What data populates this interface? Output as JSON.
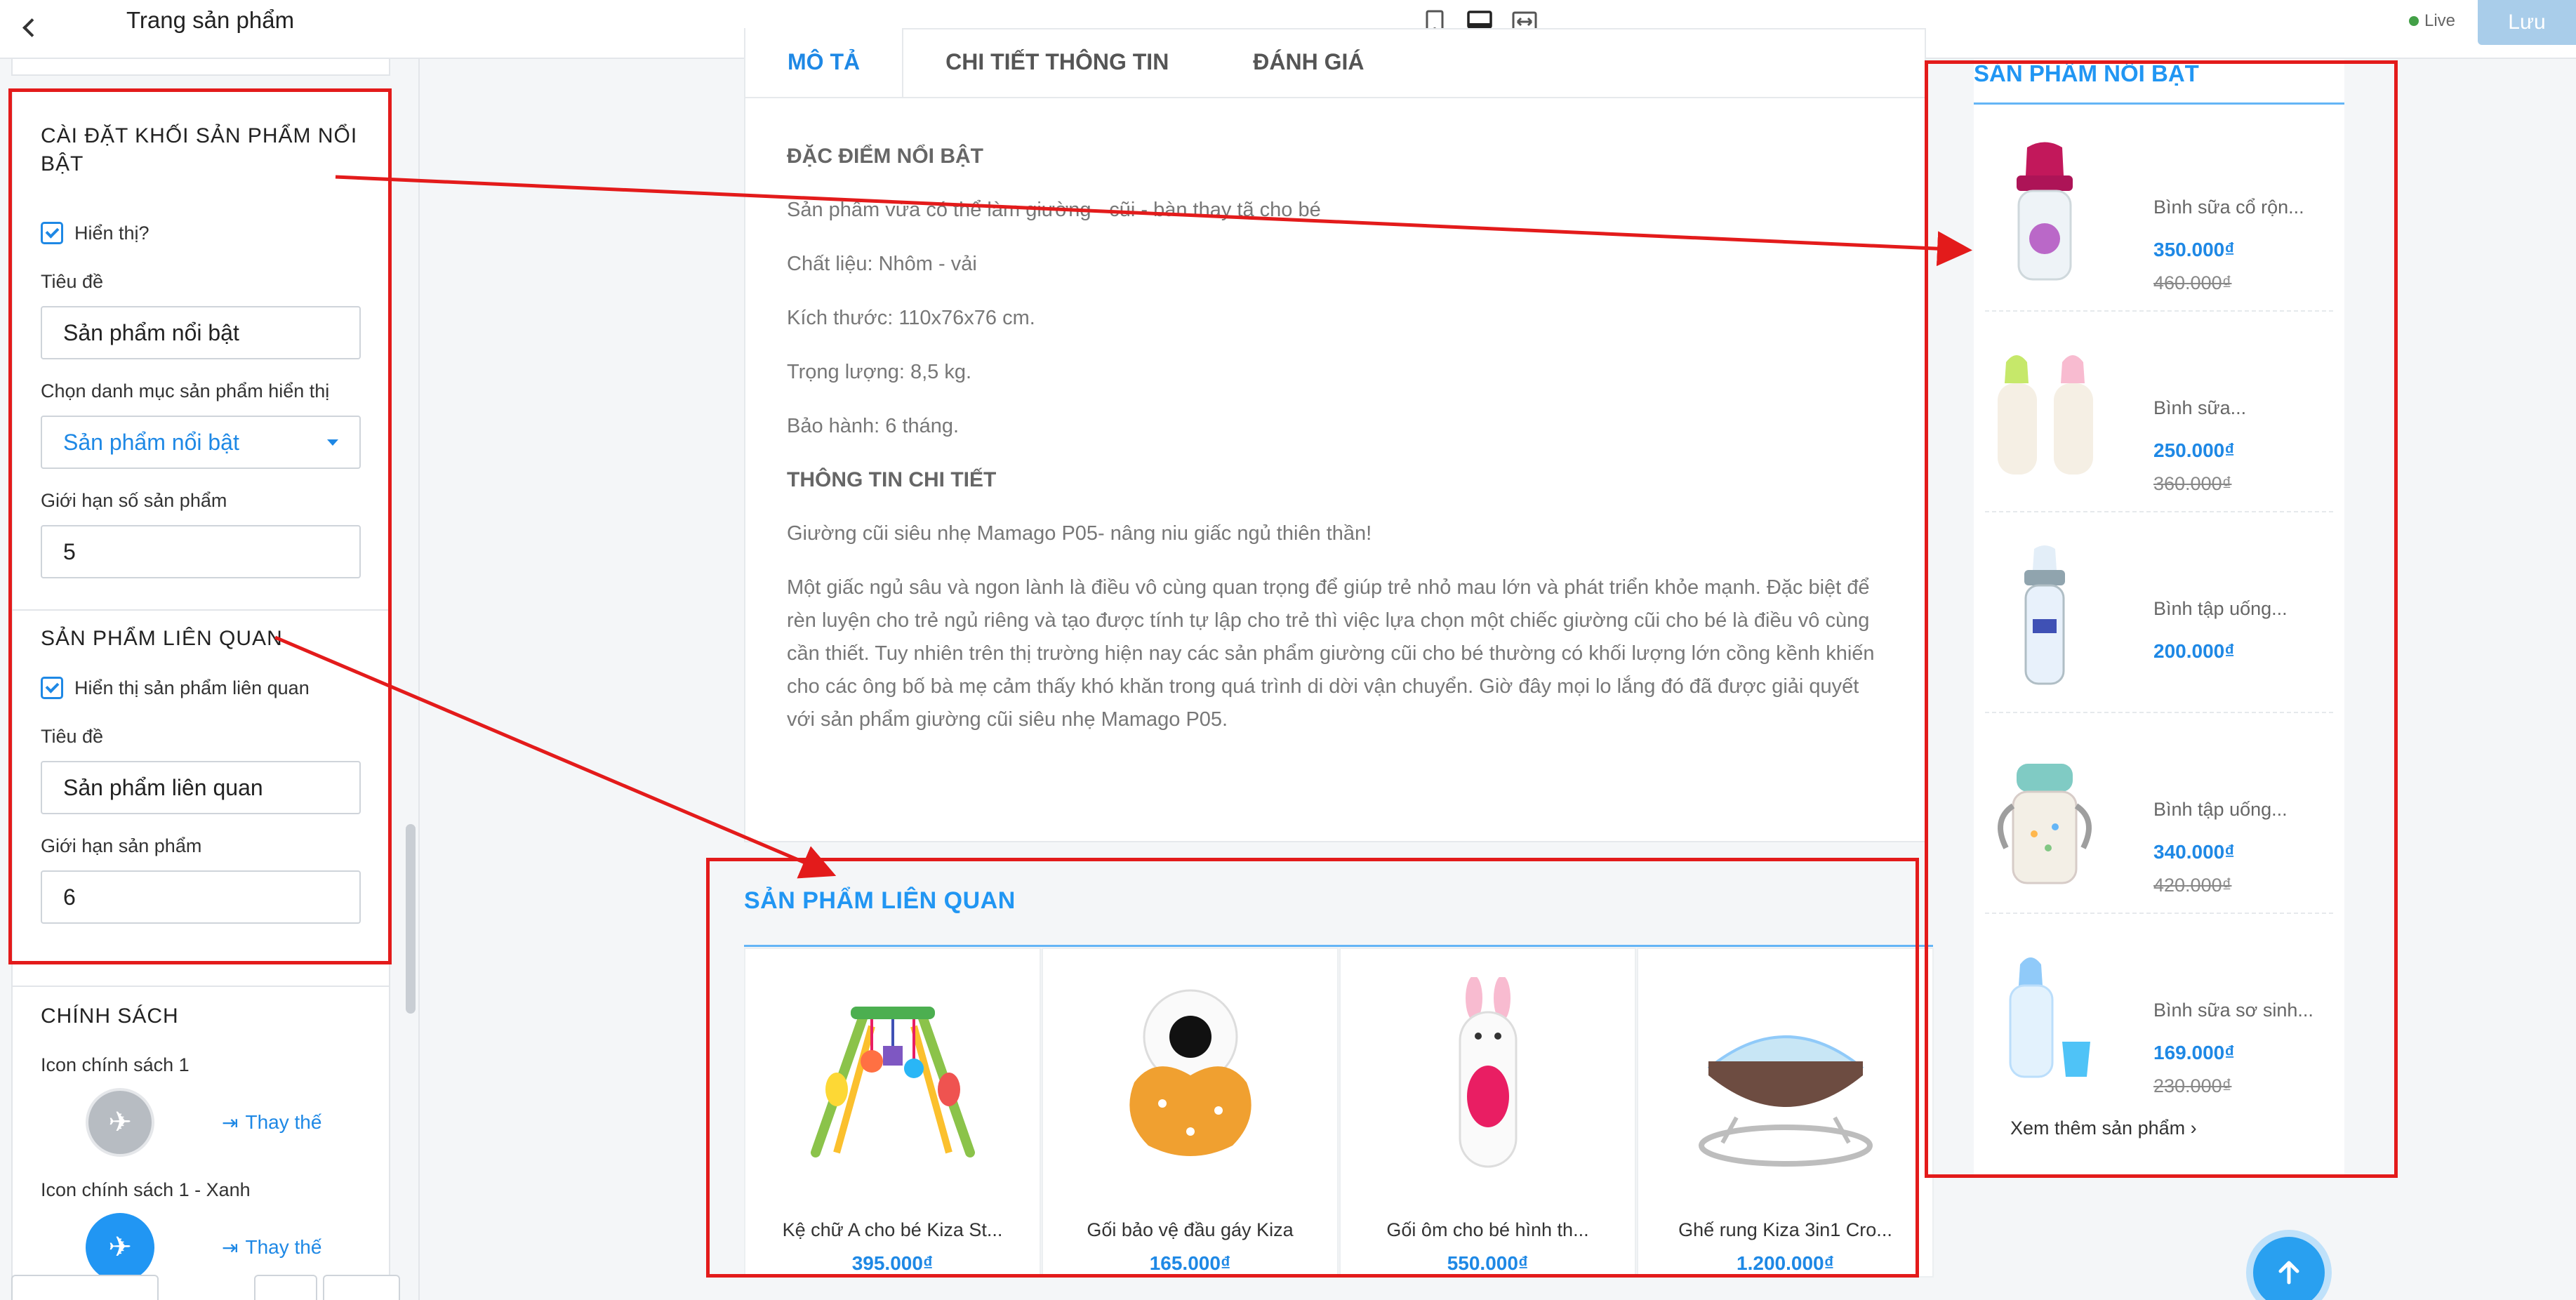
{
  "topbar": {
    "title": "Trang sản phẩm",
    "live_label": "Live",
    "save_label": "Lưu"
  },
  "left": {
    "featured_block": {
      "title": "CÀI ĐẶT KHỐI SẢN PHẨM NỔI BẬT",
      "show_label": "Hiển thị?",
      "title_label": "Tiêu đề",
      "title_value": "Sản phẩm nổi bật",
      "category_label": "Chọn danh mục sản phẩm hiển thị",
      "category_value": "Sản phẩm nổi bật",
      "limit_label": "Giới hạn số sản phẩm",
      "limit_value": "5"
    },
    "related_block": {
      "title": "SẢN PHẨM LIÊN QUAN",
      "show_label": "Hiển thị sản phẩm liên quan",
      "title_label": "Tiêu đề",
      "title_value": "Sản phẩm liên quan",
      "limit_label": "Giới hạn sản phẩm",
      "limit_value": "6"
    },
    "policy_block": {
      "title": "CHÍNH SÁCH",
      "icon1_label": "Icon chính sách 1",
      "icon1_blue_label": "Icon chính sách 1 - Xanh",
      "replace_label": "Thay thế"
    }
  },
  "tabs": [
    "MÔ TẢ",
    "CHI TIẾT THÔNG TIN",
    "ĐÁNH GIÁ"
  ],
  "description": {
    "heading1": "ĐẶC ĐIỂM NỔI BẬT",
    "lines": [
      "Sản phẩm vừa có thể làm giường - cũi - bàn thay tã cho bé",
      "Chất liệu: Nhôm - vải",
      "Kích thước: 110x76x76 cm.",
      "Trọng lượng: 8,5 kg.",
      "Bảo hành: 6 tháng."
    ],
    "heading2": "THÔNG TIN CHI TIẾT",
    "intro": "Giường cũi siêu nhẹ Mamago P05- nâng niu giấc ngủ thiên thần!",
    "paragraph": "Một giấc ngủ sâu và ngon lành là điều vô cùng quan trọng để giúp trẻ nhỏ mau lớn và phát triển khỏe mạnh. Đặc biệt để rèn luyện cho trẻ ngủ riêng và tạo được tính tự lập cho trẻ thì việc lựa chọn một chiếc giường cũi cho bé là điều vô cùng cần thiết. Tuy nhiên trên thị trường hiện nay các sản phẩm giường cũi cho bé thường có khối lượng lớn cồng kềnh khiến cho các ông bố bà mẹ cảm thấy khó khăn trong quá trình di dời vận chuyển. Giờ đây mọi lo lắng đó đã được giải quyết với sản phẩm giường cũi siêu nhẹ Mamago P05."
  },
  "related": {
    "title": "SẢN PHẨM LIÊN QUAN",
    "items": [
      {
        "name": "Kệ chữ A cho bé Kiza St...",
        "price": "395.000₫"
      },
      {
        "name": "Gối bảo vệ đầu gáy Kiza",
        "price": "165.000₫"
      },
      {
        "name": "Gối ôm cho bé hình th...",
        "price": "550.000₫"
      },
      {
        "name": "Ghế rung Kiza 3in1 Cro...",
        "price": "1.200.000₫"
      }
    ]
  },
  "featured": {
    "title": "SẢN PHẨM NỔI BẬT",
    "items": [
      {
        "name": "Bình sữa cổ rộn...",
        "price": "350.000₫",
        "old_price": "460.000₫"
      },
      {
        "name": "Bình sữa...",
        "price": "250.000₫",
        "old_price": "360.000₫"
      },
      {
        "name": "Bình tập uống...",
        "price": "200.000₫",
        "old_price": ""
      },
      {
        "name": "Bình tập uống...",
        "price": "340.000₫",
        "old_price": "420.000₫"
      },
      {
        "name": "Bình sữa sơ sinh...",
        "price": "169.000₫",
        "old_price": "230.000₫"
      }
    ],
    "more_label": "Xem thêm sản phẩm"
  },
  "colors": {
    "accent": "#1e88e5",
    "annotation": "#e31b1b",
    "save_button": "#a9cdea"
  }
}
